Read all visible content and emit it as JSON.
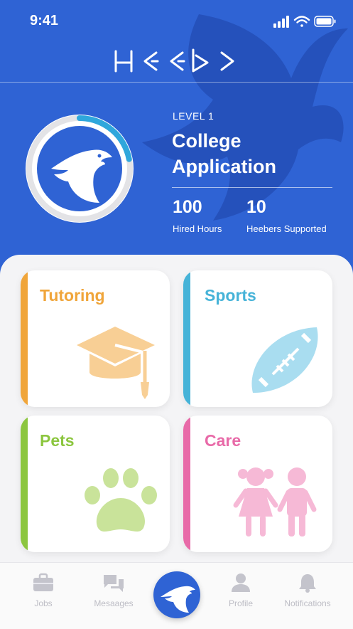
{
  "status_bar": {
    "time": "9:41"
  },
  "brand": {
    "logo_text": "Heeber"
  },
  "profile": {
    "level_label": "LEVEL 1",
    "goal_title": "College Application",
    "progress_fraction": 0.22,
    "stats": [
      {
        "value": "100",
        "label": "Hired Hours"
      },
      {
        "value": "10",
        "label": "Heebers Supported"
      }
    ]
  },
  "categories": [
    {
      "label": "Tutoring",
      "color": "#f0a53a",
      "icon": "graduation-cap-icon"
    },
    {
      "label": "Sports",
      "color": "#46b3d8",
      "icon": "football-icon"
    },
    {
      "label": "Pets",
      "color": "#8cc63f",
      "icon": "paw-icon"
    },
    {
      "label": "Care",
      "color": "#e86aa8",
      "icon": "children-icon"
    }
  ],
  "nav": {
    "items": [
      {
        "label": "Jobs",
        "icon": "briefcase-icon"
      },
      {
        "label": "Mesaages",
        "icon": "chat-icon"
      },
      {
        "label": "Profile",
        "icon": "person-icon"
      },
      {
        "label": "Notifications",
        "icon": "bell-icon"
      }
    ],
    "center_icon": "eagle-icon"
  },
  "colors": {
    "brand_blue": "#2f63d4",
    "progress": "#2fa7dc"
  }
}
